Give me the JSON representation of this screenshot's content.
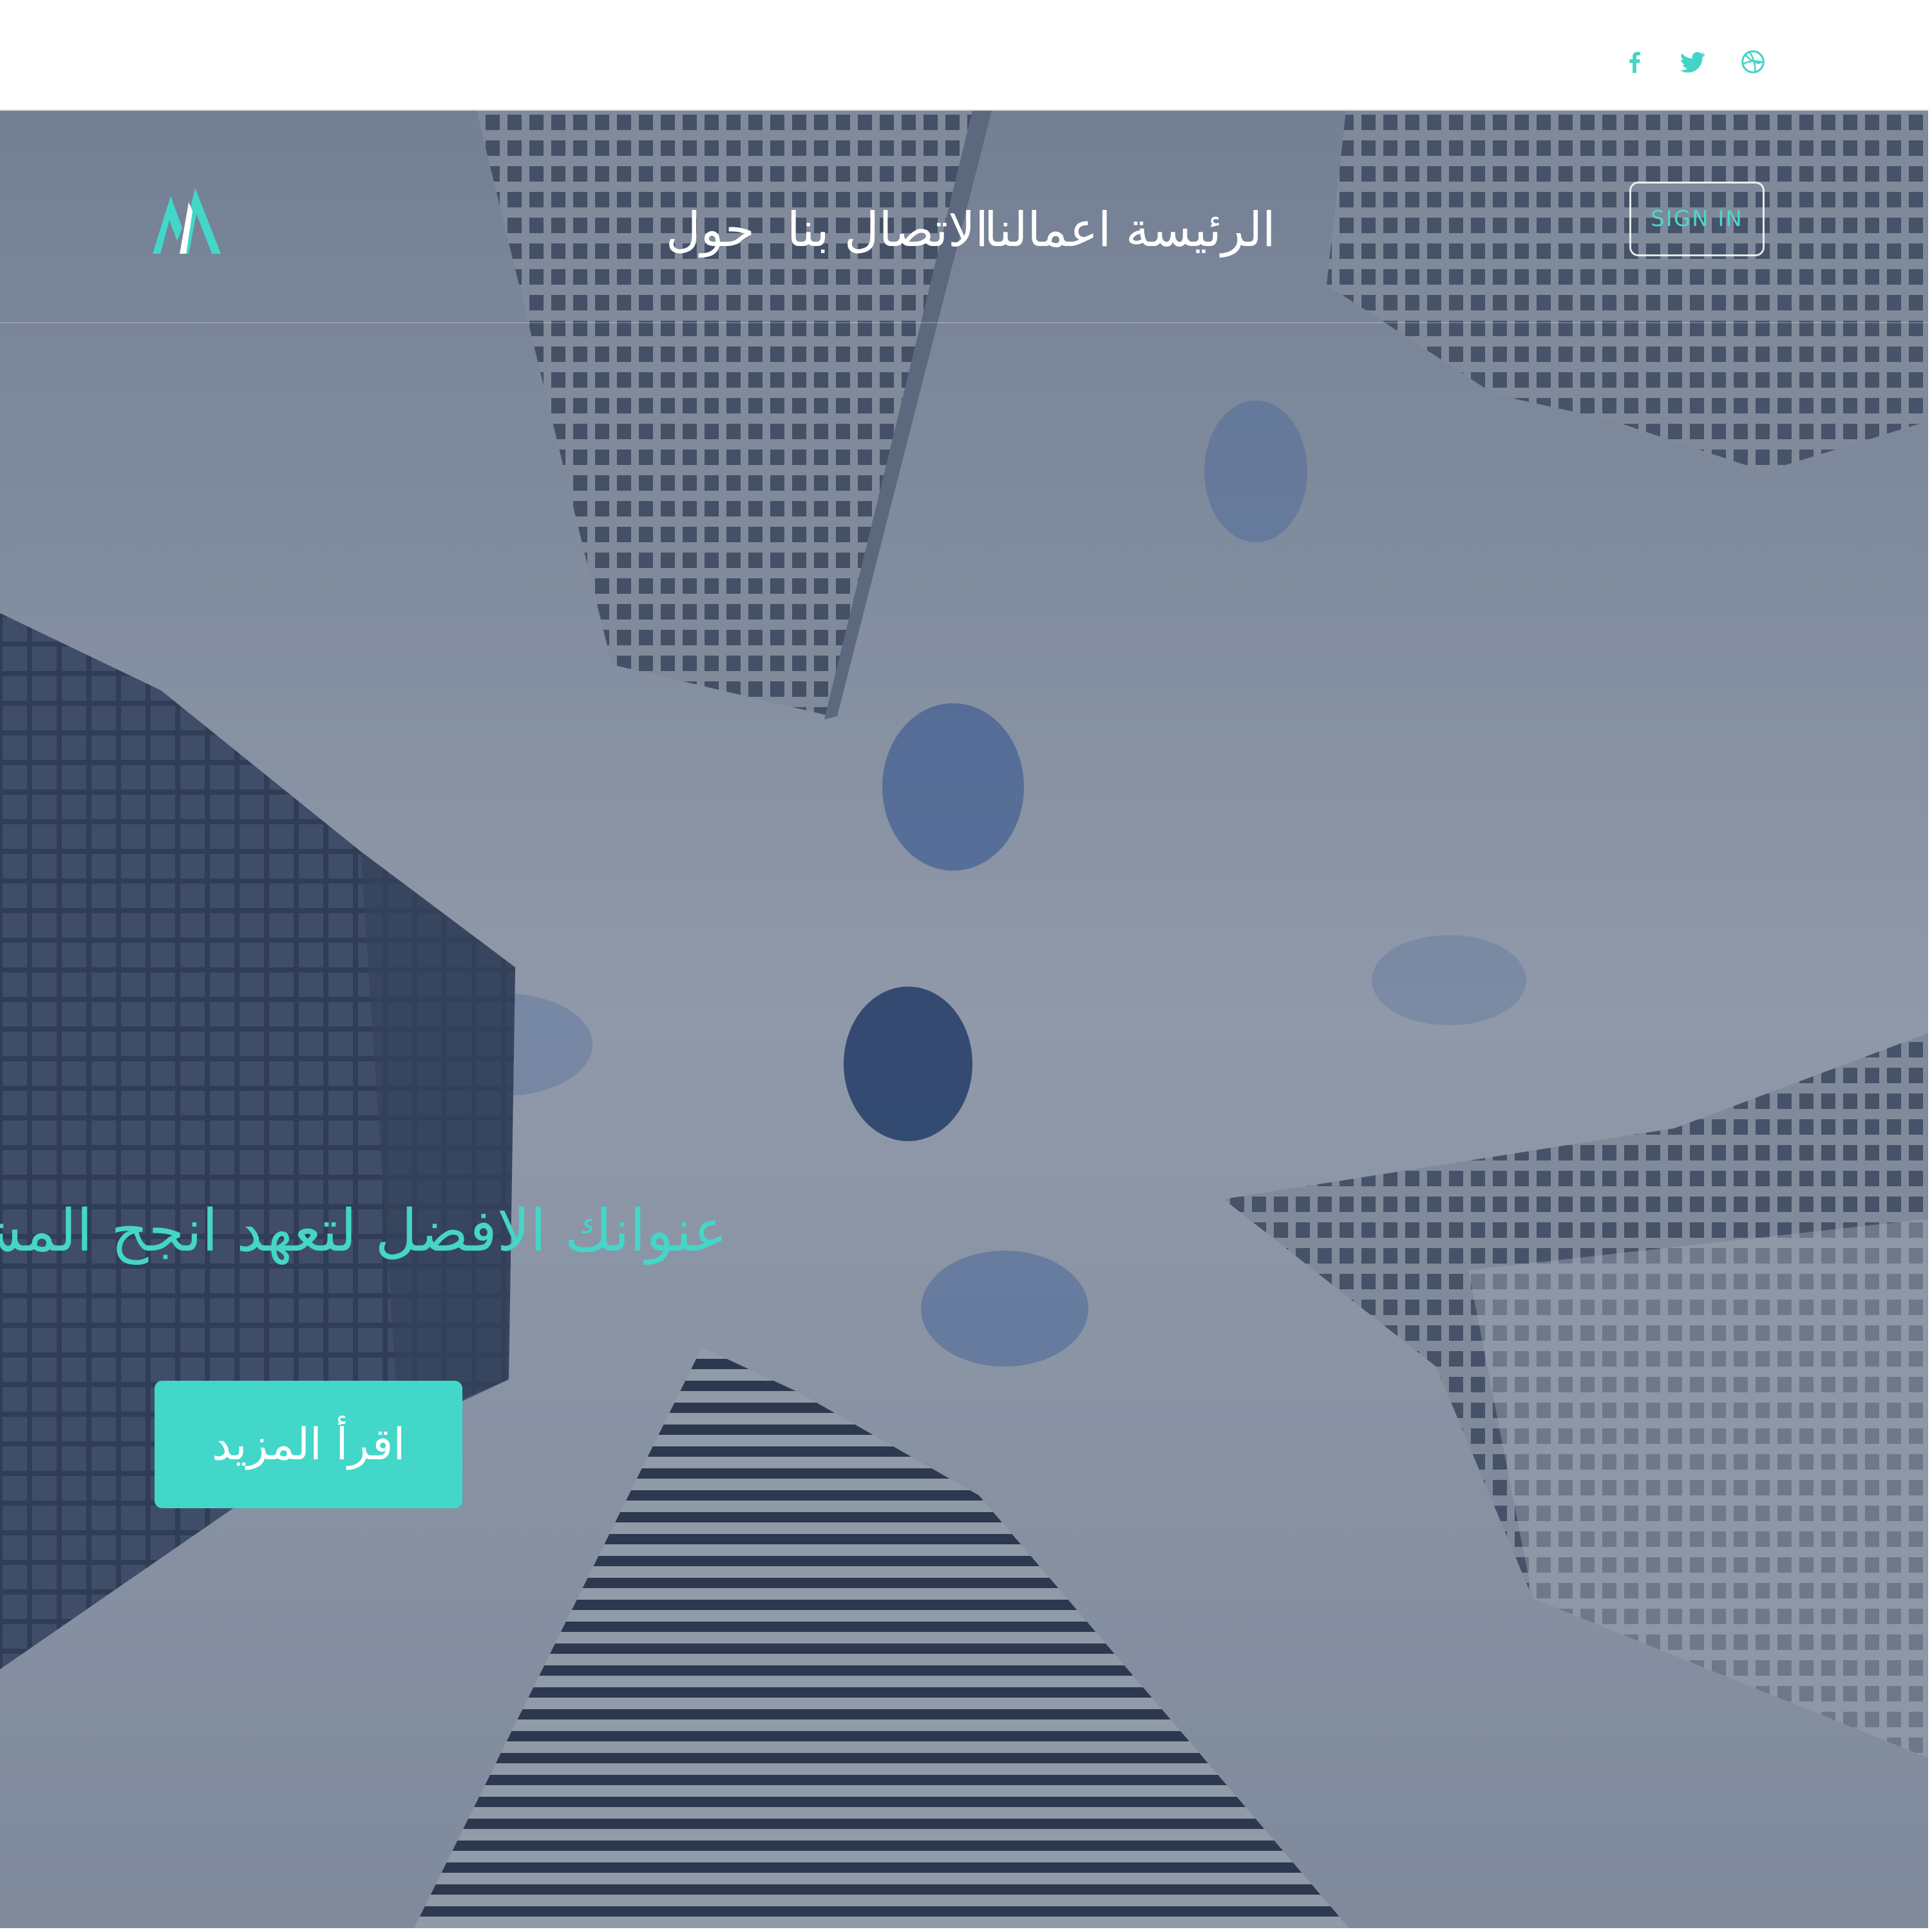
{
  "topbar": {
    "social": [
      {
        "name": "facebook",
        "icon": "facebook-icon"
      },
      {
        "name": "twitter",
        "icon": "twitter-icon"
      },
      {
        "name": "dribbble",
        "icon": "dribbble-icon"
      }
    ]
  },
  "header": {
    "logo": "logo-icon",
    "nav": [
      {
        "label": "الرئيسة"
      },
      {
        "label": "اعمالنا"
      },
      {
        "label": "الاتصال بنا"
      },
      {
        "label": "حول"
      }
    ],
    "signin_label": "SIGN IN"
  },
  "hero": {
    "headline": "عنوانك الافضل لتعهد انجح المشاريع",
    "cta_label": "اقرأ المزيد",
    "background": "skyscrapers-looking-up-photo"
  },
  "colors": {
    "accent": "#42d7c9",
    "white": "#ffffff",
    "overlay": "#233250"
  }
}
